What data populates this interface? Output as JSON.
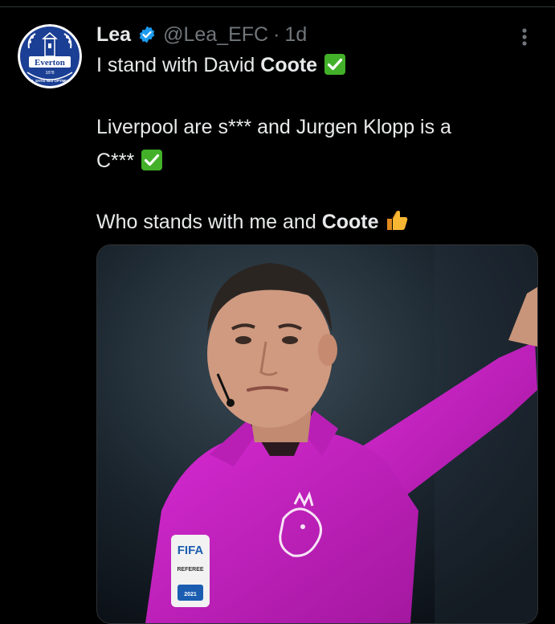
{
  "tweet": {
    "author": {
      "display_name": "Lea",
      "handle": "@Lea_EFC",
      "separator": "·",
      "timestamp": "1d",
      "verified": true,
      "avatar_crest_text": "Everton",
      "avatar_year": "1878",
      "avatar_motto": "NIL SATIS NISI OPTIMUM"
    },
    "body": {
      "line1_prefix": "I stand with David ",
      "line1_bold": "Coote",
      "line2": "Liverpool are s*** and Jurgen Klopp is a",
      "line3": "C***",
      "line4_prefix": "Who stands with me and ",
      "line4_bold": "Coote"
    },
    "icons": {
      "verified": "verified-badge-icon",
      "more": "more-options-icon",
      "check": "check-mark-emoji",
      "thumbs_up": "thumbs-up-emoji"
    },
    "media": {
      "badge_top": "FIFA",
      "badge_sub": "REFEREE",
      "badge_year": "2021"
    },
    "colors": {
      "background": "#000000",
      "text": "#e7e9ea",
      "muted": "#71767b",
      "verified": "#1d9bf0",
      "everton_blue": "#1b3f94",
      "check_green": "#43b02a",
      "jersey": "#c21fbd"
    }
  }
}
